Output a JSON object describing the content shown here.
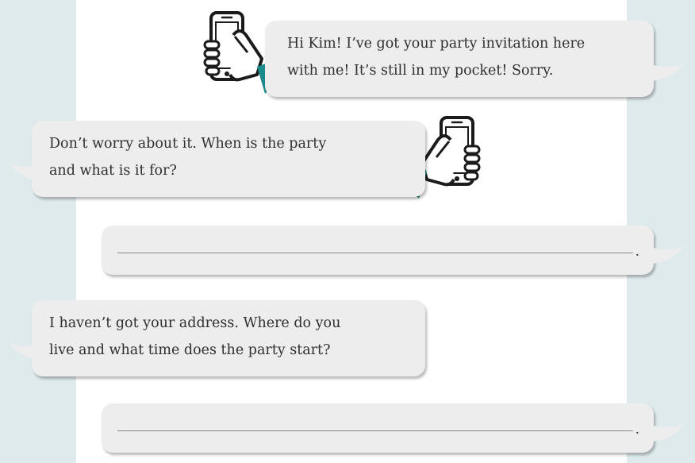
{
  "colors": {
    "side_panel": "#deeaec",
    "bubble": "#ededed",
    "cuff": "#1a8a8a",
    "phone": "#1b1b1b"
  },
  "icons": [
    "phone-in-hand-icon"
  ],
  "messages": [
    {
      "from": "friend",
      "text": "Hi Kim! I’ve got your party invitation here\nwith me! It’s still in my pocket! Sorry."
    },
    {
      "from": "kim",
      "text": "Don’t worry about it. When is the party\nand what is it for?"
    },
    {
      "from": "friend",
      "answer_blank": true,
      "end_mark": "."
    },
    {
      "from": "kim",
      "text": "I haven’t got your address. Where do you\nlive and what time does the party start?"
    },
    {
      "from": "friend",
      "answer_blank": true,
      "end_mark": "."
    }
  ]
}
